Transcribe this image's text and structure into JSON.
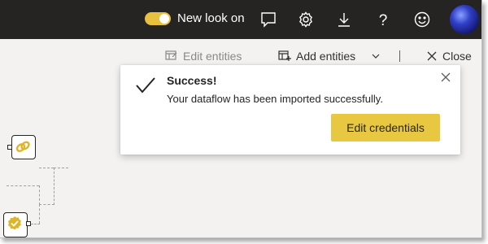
{
  "topbar": {
    "toggle_label": "New look on",
    "toggle_state": "on",
    "icons": [
      "feedback-icon",
      "settings-gear-icon",
      "download-icon",
      "help-icon",
      "smiley-icon"
    ],
    "avatar": "user-avatar"
  },
  "toolbar": {
    "edit_entities": "Edit entities",
    "add_entities": "Add entities",
    "close": "Close"
  },
  "notification": {
    "title": "Success!",
    "message": "Your dataflow has been imported successfully.",
    "button": "Edit credentials"
  },
  "colors": {
    "topbar_bg": "#252423",
    "accent_yellow": "#e8c840",
    "canvas_bg": "#f3f2f1"
  }
}
